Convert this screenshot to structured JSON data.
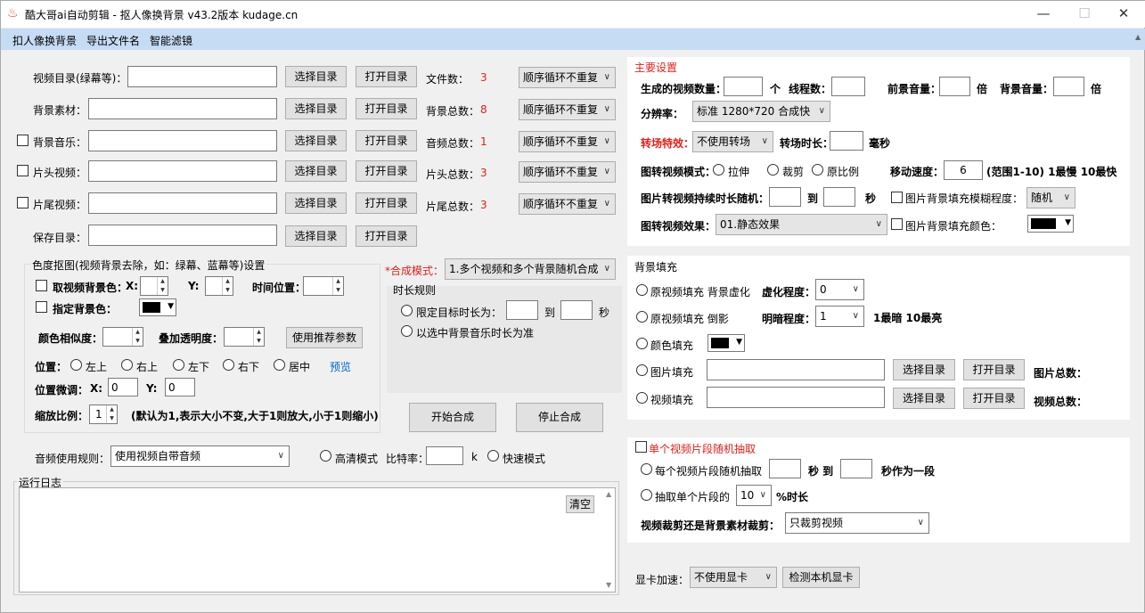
{
  "window": {
    "title": "酷大哥ai自动剪辑 - 抠人像换背景  v43.2版本  kudage.cn",
    "minimize": "—",
    "maximize": "☐",
    "close": "✕"
  },
  "menu": [
    "扣人像换背景",
    "导出文件名",
    "智能滤镜"
  ],
  "icons": {
    "app": "flame-icon",
    "dropdown": "chevron-down-icon",
    "spin": "spin-up-down-icon"
  },
  "colors": {
    "menubar": "#c6dcf5",
    "accent_red": "#e0201c",
    "link": "#0066cc"
  },
  "left": {
    "rows": [
      {
        "label": "视频目录(绿幕等)：",
        "check": false,
        "btn1": "选择目录",
        "btn2": "打开目录",
        "count_label": "文件数：",
        "count": "3",
        "mode": "顺序循环不重复"
      },
      {
        "label": "背景素材：",
        "check": false,
        "btn1": "选择目录",
        "btn2": "打开目录",
        "count_label": "背景总数：",
        "count": "8",
        "mode": "顺序循环不重复"
      },
      {
        "label": "背景音乐：",
        "check": true,
        "btn1": "选择目录",
        "btn2": "打开目录",
        "count_label": "音频总数：",
        "count": "1",
        "mode": "顺序循环不重复"
      },
      {
        "label": "片头视频：",
        "check": true,
        "btn1": "选择目录",
        "btn2": "打开目录",
        "count_label": "片头总数：",
        "count": "3",
        "mode": "顺序循环不重复"
      },
      {
        "label": "片尾视频：",
        "check": true,
        "btn1": "选择目录",
        "btn2": "打开目录",
        "count_label": "片尾总数：",
        "count": "3",
        "mode": "顺序循环不重复"
      },
      {
        "label": "保存目录：",
        "check": false,
        "btn1": "选择目录",
        "btn2": "打开目录"
      }
    ],
    "chroma": {
      "title": "色度抠图(视频背景去除，如：绿幕、蓝幕等)设置",
      "take_bg": "取视频背景色：",
      "x": "X:",
      "y": "Y:",
      "time_pos": "时间位置：",
      "set_bg": "指定背景色：",
      "similarity": "颜色相似度：",
      "opacity": "叠加透明度：",
      "recommend": "使用推荐参数",
      "pos_label": "位置：",
      "positions": [
        "左上",
        "右上",
        "左下",
        "右下",
        "居中"
      ],
      "preview": "预览",
      "fine": "位置微调：",
      "fine_x_label": "X:",
      "fine_x": "0",
      "fine_y_label": "Y:",
      "fine_y": "0",
      "scale_label": "缩放比例：",
      "scale": "1",
      "scale_note": "(默认为1,表示大小不变,大于1则放大,小于1则缩小)"
    },
    "compose": {
      "label": "*合成模式：",
      "value": "1.多个视频和多个背景随机合成"
    },
    "duration": {
      "title": "时长规则",
      "opt1": "限定目标时长为：",
      "to": "到",
      "sec": "秒",
      "opt2": "以选中背景音乐时长为准"
    },
    "start": "开始合成",
    "stop": "停止合成",
    "audio": {
      "label": "音频使用规则：",
      "value": "使用视频自带音频",
      "hd": "高清模式",
      "bitrate": "比特率：",
      "k": "k",
      "fast": "快速模式"
    },
    "log": {
      "title": "运行日志",
      "clear": "清空"
    }
  },
  "right": {
    "main": {
      "title": "主要设置",
      "count_label": "生成的视频数量：",
      "unit": "个",
      "threads": "线程数：",
      "fg_vol": "前景音量：",
      "times": "倍",
      "bg_vol": "背景音量：",
      "times2": "倍",
      "res_label": "分辨率：",
      "res": "标准 1280*720 合成快",
      "trans_label": "转场特效：",
      "trans": "不使用转场",
      "trans_dur": "转场时长：",
      "ms": "毫秒",
      "img_mode": "图转视频模式：",
      "img_opts": [
        "拉伸",
        "裁剪",
        "原比例"
      ],
      "speed_label": "移动速度：",
      "speed": "6",
      "speed_note": "(范围1-10) 1最慢 10最快",
      "img_dur": "图片转视频持续时长随机：",
      "to": "到",
      "sec": "秒",
      "blur_chk": "图片背景填充模糊程度：",
      "blur": "随机",
      "effect_label": "图转视频效果：",
      "effect": "01.静态效果",
      "fill_color": "图片背景填充颜色："
    },
    "bgfill": {
      "title": "背景填充",
      "o1": "原视频填充 背景虚化",
      "blur": "虚化程度：",
      "blur_val": "0",
      "o2": "原视频填充 倒影",
      "bright": "明暗程度：",
      "bright_val": "1",
      "bright_note": "1最暗 10最亮",
      "o3": "颜色填充",
      "o4": "图片填充",
      "pick": "选择目录",
      "open": "打开目录",
      "img_total": "图片总数：",
      "o5": "视频填充",
      "vid_total": "视频总数："
    },
    "clip": {
      "title": "单个视频片段随机抽取",
      "o1": "每个视频片段随机抽取",
      "sec_to": "秒 到",
      "seg": "秒作为一段",
      "o2": "抽取单个片段的",
      "pct": "10",
      "pct_note": "%时长",
      "crop_label": "视频裁剪还是背景素材裁剪：",
      "crop": "只裁剪视频"
    },
    "gpu": {
      "label": "显卡加速：",
      "value": "不使用显卡",
      "detect": "检测本机显卡"
    }
  }
}
